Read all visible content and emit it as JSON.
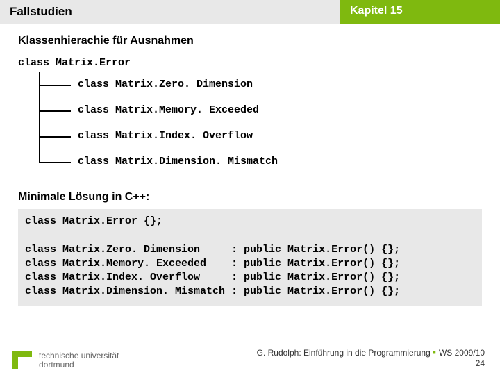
{
  "header": {
    "left": "Fallstudien",
    "right": "Kapitel 15"
  },
  "subtitle": "Klassenhierachie für Ausnahmen",
  "rootClass": "class Matrix.Error",
  "tree": [
    "class Matrix.Zero. Dimension",
    "class Matrix.Memory. Exceeded",
    "class Matrix.Index. Overflow",
    "class Matrix.Dimension. Mismatch"
  ],
  "section2": "Minimale Lösung in C++:",
  "code": "class Matrix.Error {};\n\nclass Matrix.Zero. Dimension     : public Matrix.Error() {};\nclass Matrix.Memory. Exceeded    : public Matrix.Error() {};\nclass Matrix.Index. Overflow     : public Matrix.Error() {};\nclass Matrix.Dimension. Mismatch : public Matrix.Error() {};",
  "footer": {
    "uni1": "technische universität",
    "uni2": "dortmund",
    "author": "G. Rudolph: Einführung in die Programmierung",
    "term": "WS 2009/10",
    "page": "24"
  }
}
